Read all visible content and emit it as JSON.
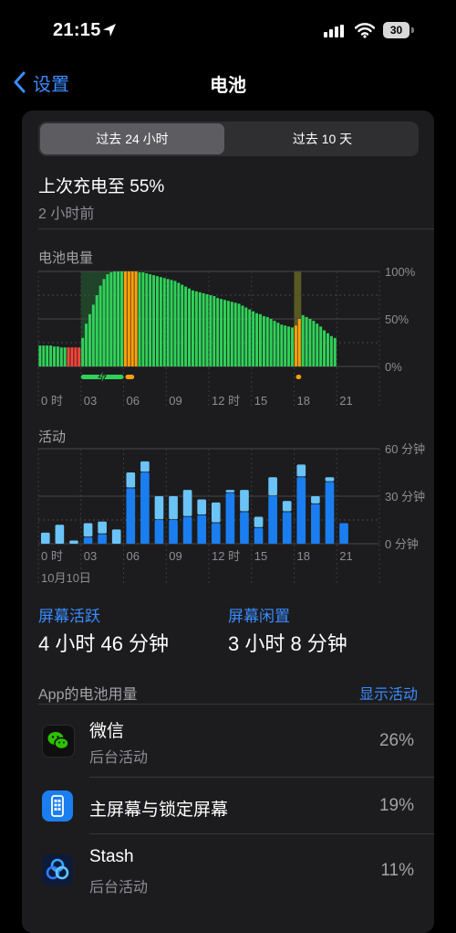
{
  "status": {
    "time": "21:15",
    "battery_level": "30"
  },
  "nav": {
    "back_label": "设置",
    "title": "电池"
  },
  "segments": {
    "active": "过去 24 小时",
    "inactive": "过去 10 天"
  },
  "last_charge": {
    "title": "上次充电至 55%",
    "ago": "2 小时前"
  },
  "battery_chart": {
    "label": "电池电量",
    "x_ticks": [
      "0 时",
      "03",
      "06",
      "09",
      "12 时",
      "15",
      "18",
      "21"
    ],
    "y_ticks": [
      "100%",
      "50%",
      "0%"
    ],
    "colors": {
      "normal": "#30d158",
      "low": "#ff453a",
      "low_power": "#ff9f0a",
      "charging_band": "#30d158"
    },
    "chart_data": {
      "type": "bar",
      "xlabel": "",
      "ylabel": "",
      "ylim": [
        0,
        100
      ],
      "x_unit": "hour",
      "levels": [
        {
          "t": 0.0,
          "v": 22,
          "c": "normal"
        },
        {
          "t": 0.25,
          "v": 22,
          "c": "normal"
        },
        {
          "t": 0.5,
          "v": 22,
          "c": "normal"
        },
        {
          "t": 0.75,
          "v": 22,
          "c": "normal"
        },
        {
          "t": 1.0,
          "v": 21,
          "c": "normal"
        },
        {
          "t": 1.25,
          "v": 21,
          "c": "normal"
        },
        {
          "t": 1.5,
          "v": 20,
          "c": "normal"
        },
        {
          "t": 1.75,
          "v": 20,
          "c": "normal"
        },
        {
          "t": 2.0,
          "v": 20,
          "c": "low"
        },
        {
          "t": 2.25,
          "v": 20,
          "c": "low"
        },
        {
          "t": 2.5,
          "v": 20,
          "c": "low"
        },
        {
          "t": 2.75,
          "v": 20,
          "c": "low"
        },
        {
          "t": 3.0,
          "v": 30,
          "c": "normal"
        },
        {
          "t": 3.25,
          "v": 45,
          "c": "normal"
        },
        {
          "t": 3.5,
          "v": 55,
          "c": "normal"
        },
        {
          "t": 3.75,
          "v": 65,
          "c": "normal"
        },
        {
          "t": 4.0,
          "v": 75,
          "c": "normal"
        },
        {
          "t": 4.25,
          "v": 85,
          "c": "normal"
        },
        {
          "t": 4.5,
          "v": 92,
          "c": "normal"
        },
        {
          "t": 4.75,
          "v": 97,
          "c": "normal"
        },
        {
          "t": 5.0,
          "v": 99,
          "c": "normal"
        },
        {
          "t": 5.25,
          "v": 100,
          "c": "normal"
        },
        {
          "t": 5.5,
          "v": 100,
          "c": "normal"
        },
        {
          "t": 5.75,
          "v": 100,
          "c": "normal"
        },
        {
          "t": 6.0,
          "v": 100,
          "c": "low_power"
        },
        {
          "t": 6.25,
          "v": 100,
          "c": "low_power"
        },
        {
          "t": 6.5,
          "v": 100,
          "c": "low_power"
        },
        {
          "t": 6.75,
          "v": 100,
          "c": "low_power"
        },
        {
          "t": 7.0,
          "v": 99,
          "c": "normal"
        },
        {
          "t": 7.25,
          "v": 99,
          "c": "normal"
        },
        {
          "t": 7.5,
          "v": 98,
          "c": "normal"
        },
        {
          "t": 7.75,
          "v": 97,
          "c": "normal"
        },
        {
          "t": 8.0,
          "v": 96,
          "c": "normal"
        },
        {
          "t": 8.25,
          "v": 95,
          "c": "normal"
        },
        {
          "t": 8.5,
          "v": 94,
          "c": "normal"
        },
        {
          "t": 8.75,
          "v": 93,
          "c": "normal"
        },
        {
          "t": 9.0,
          "v": 92,
          "c": "normal"
        },
        {
          "t": 9.25,
          "v": 91,
          "c": "normal"
        },
        {
          "t": 9.5,
          "v": 90,
          "c": "normal"
        },
        {
          "t": 9.75,
          "v": 88,
          "c": "normal"
        },
        {
          "t": 10.0,
          "v": 86,
          "c": "normal"
        },
        {
          "t": 10.25,
          "v": 84,
          "c": "normal"
        },
        {
          "t": 10.5,
          "v": 82,
          "c": "normal"
        },
        {
          "t": 10.75,
          "v": 80,
          "c": "normal"
        },
        {
          "t": 11.0,
          "v": 79,
          "c": "normal"
        },
        {
          "t": 11.25,
          "v": 78,
          "c": "normal"
        },
        {
          "t": 11.5,
          "v": 77,
          "c": "normal"
        },
        {
          "t": 11.75,
          "v": 76,
          "c": "normal"
        },
        {
          "t": 12.0,
          "v": 75,
          "c": "normal"
        },
        {
          "t": 12.25,
          "v": 74,
          "c": "normal"
        },
        {
          "t": 12.5,
          "v": 72,
          "c": "normal"
        },
        {
          "t": 12.75,
          "v": 71,
          "c": "normal"
        },
        {
          "t": 13.0,
          "v": 70,
          "c": "normal"
        },
        {
          "t": 13.25,
          "v": 69,
          "c": "normal"
        },
        {
          "t": 13.5,
          "v": 68,
          "c": "normal"
        },
        {
          "t": 13.75,
          "v": 67,
          "c": "normal"
        },
        {
          "t": 14.0,
          "v": 66,
          "c": "normal"
        },
        {
          "t": 14.25,
          "v": 64,
          "c": "normal"
        },
        {
          "t": 14.5,
          "v": 62,
          "c": "normal"
        },
        {
          "t": 14.75,
          "v": 60,
          "c": "normal"
        },
        {
          "t": 15.0,
          "v": 58,
          "c": "normal"
        },
        {
          "t": 15.25,
          "v": 56,
          "c": "normal"
        },
        {
          "t": 15.5,
          "v": 55,
          "c": "normal"
        },
        {
          "t": 15.75,
          "v": 53,
          "c": "normal"
        },
        {
          "t": 16.0,
          "v": 52,
          "c": "normal"
        },
        {
          "t": 16.25,
          "v": 50,
          "c": "normal"
        },
        {
          "t": 16.5,
          "v": 48,
          "c": "normal"
        },
        {
          "t": 16.75,
          "v": 46,
          "c": "normal"
        },
        {
          "t": 17.0,
          "v": 44,
          "c": "normal"
        },
        {
          "t": 17.25,
          "v": 43,
          "c": "normal"
        },
        {
          "t": 17.5,
          "v": 42,
          "c": "normal"
        },
        {
          "t": 17.75,
          "v": 41,
          "c": "normal"
        },
        {
          "t": 18.0,
          "v": 43,
          "c": "low_power"
        },
        {
          "t": 18.25,
          "v": 50,
          "c": "low_power"
        },
        {
          "t": 18.5,
          "v": 54,
          "c": "normal"
        },
        {
          "t": 18.75,
          "v": 52,
          "c": "normal"
        },
        {
          "t": 19.0,
          "v": 50,
          "c": "normal"
        },
        {
          "t": 19.25,
          "v": 48,
          "c": "normal"
        },
        {
          "t": 19.5,
          "v": 45,
          "c": "normal"
        },
        {
          "t": 19.75,
          "v": 42,
          "c": "normal"
        },
        {
          "t": 20.0,
          "v": 38,
          "c": "normal"
        },
        {
          "t": 20.25,
          "v": 35,
          "c": "normal"
        },
        {
          "t": 20.5,
          "v": 32,
          "c": "normal"
        },
        {
          "t": 20.75,
          "v": 30,
          "c": "normal"
        }
      ],
      "charging_intervals": [
        [
          3.0,
          6.0
        ],
        [
          18.0,
          18.5
        ]
      ],
      "low_power_intervals": [
        [
          6.0,
          7.0
        ],
        [
          18.0,
          18.5
        ]
      ],
      "charging_markers": [
        [
          3.0,
          6.0
        ]
      ],
      "low_power_markers": [
        [
          6.0,
          6.75
        ],
        [
          18.0,
          18.5
        ]
      ]
    }
  },
  "activity_chart": {
    "label": "活动",
    "x_ticks": [
      "0 时",
      "03",
      "06",
      "09",
      "12 时",
      "15",
      "18",
      "21"
    ],
    "y_ticks": [
      "60 分钟",
      "30 分钟",
      "0 分钟"
    ],
    "date_label": "10月10日",
    "colors": {
      "screen_on": "#1a7ef0",
      "screen_off": "#6ac4f7"
    },
    "chart_data": {
      "type": "bar",
      "xlabel": "",
      "ylabel": "",
      "ylim": [
        0,
        60
      ],
      "categories": [
        "0",
        "1",
        "2",
        "3",
        "4",
        "5",
        "6",
        "7",
        "8",
        "9",
        "10",
        "11",
        "12",
        "13",
        "14",
        "15",
        "16",
        "17",
        "18",
        "19",
        "20",
        "21"
      ],
      "series": [
        {
          "name": "屏幕活跃",
          "values": [
            0,
            0,
            0,
            4,
            6,
            0,
            35,
            45,
            15,
            15,
            17,
            18,
            13,
            32,
            20,
            10,
            30,
            20,
            42,
            25,
            39,
            13
          ]
        },
        {
          "name": "屏幕闲置",
          "values": [
            7,
            12,
            2,
            9,
            8,
            9,
            10,
            7,
            15,
            15,
            17,
            10,
            13,
            2,
            14,
            7,
            12,
            7,
            8,
            5,
            3,
            0
          ]
        }
      ]
    }
  },
  "screen_stats": {
    "active_label": "屏幕活跃",
    "active_value": "4 小时 46 分钟",
    "idle_label": "屏幕闲置",
    "idle_value": "3 小时 8 分钟"
  },
  "apps_header": {
    "title": "App的电池用量",
    "action": "显示活动"
  },
  "apps": [
    {
      "name": "微信",
      "sub": "后台活动",
      "pct": "26%",
      "icon": "wechat-icon"
    },
    {
      "name": "主屏幕与锁定屏幕",
      "sub": "",
      "pct": "19%",
      "icon": "home-screen-icon"
    },
    {
      "name": "Stash",
      "sub": "后台活动",
      "pct": "11%",
      "icon": "stash-icon"
    }
  ]
}
